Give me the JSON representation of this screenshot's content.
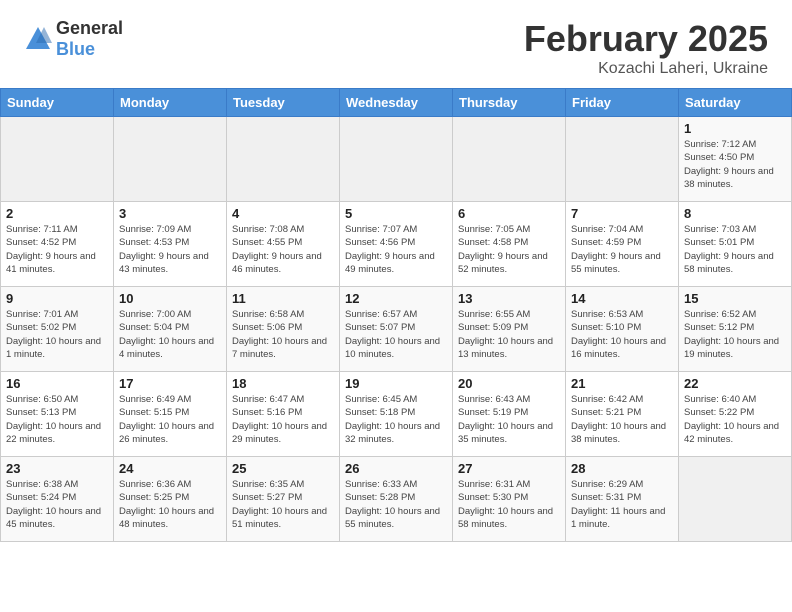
{
  "header": {
    "logo": {
      "general": "General",
      "blue": "Blue"
    },
    "title": "February 2025",
    "subtitle": "Kozachi Laheri, Ukraine"
  },
  "calendar": {
    "weekdays": [
      "Sunday",
      "Monday",
      "Tuesday",
      "Wednesday",
      "Thursday",
      "Friday",
      "Saturday"
    ],
    "weeks": [
      [
        {
          "day": "",
          "info": ""
        },
        {
          "day": "",
          "info": ""
        },
        {
          "day": "",
          "info": ""
        },
        {
          "day": "",
          "info": ""
        },
        {
          "day": "",
          "info": ""
        },
        {
          "day": "",
          "info": ""
        },
        {
          "day": "1",
          "info": "Sunrise: 7:12 AM\nSunset: 4:50 PM\nDaylight: 9 hours and 38 minutes."
        }
      ],
      [
        {
          "day": "2",
          "info": "Sunrise: 7:11 AM\nSunset: 4:52 PM\nDaylight: 9 hours and 41 minutes."
        },
        {
          "day": "3",
          "info": "Sunrise: 7:09 AM\nSunset: 4:53 PM\nDaylight: 9 hours and 43 minutes."
        },
        {
          "day": "4",
          "info": "Sunrise: 7:08 AM\nSunset: 4:55 PM\nDaylight: 9 hours and 46 minutes."
        },
        {
          "day": "5",
          "info": "Sunrise: 7:07 AM\nSunset: 4:56 PM\nDaylight: 9 hours and 49 minutes."
        },
        {
          "day": "6",
          "info": "Sunrise: 7:05 AM\nSunset: 4:58 PM\nDaylight: 9 hours and 52 minutes."
        },
        {
          "day": "7",
          "info": "Sunrise: 7:04 AM\nSunset: 4:59 PM\nDaylight: 9 hours and 55 minutes."
        },
        {
          "day": "8",
          "info": "Sunrise: 7:03 AM\nSunset: 5:01 PM\nDaylight: 9 hours and 58 minutes."
        }
      ],
      [
        {
          "day": "9",
          "info": "Sunrise: 7:01 AM\nSunset: 5:02 PM\nDaylight: 10 hours and 1 minute."
        },
        {
          "day": "10",
          "info": "Sunrise: 7:00 AM\nSunset: 5:04 PM\nDaylight: 10 hours and 4 minutes."
        },
        {
          "day": "11",
          "info": "Sunrise: 6:58 AM\nSunset: 5:06 PM\nDaylight: 10 hours and 7 minutes."
        },
        {
          "day": "12",
          "info": "Sunrise: 6:57 AM\nSunset: 5:07 PM\nDaylight: 10 hours and 10 minutes."
        },
        {
          "day": "13",
          "info": "Sunrise: 6:55 AM\nSunset: 5:09 PM\nDaylight: 10 hours and 13 minutes."
        },
        {
          "day": "14",
          "info": "Sunrise: 6:53 AM\nSunset: 5:10 PM\nDaylight: 10 hours and 16 minutes."
        },
        {
          "day": "15",
          "info": "Sunrise: 6:52 AM\nSunset: 5:12 PM\nDaylight: 10 hours and 19 minutes."
        }
      ],
      [
        {
          "day": "16",
          "info": "Sunrise: 6:50 AM\nSunset: 5:13 PM\nDaylight: 10 hours and 22 minutes."
        },
        {
          "day": "17",
          "info": "Sunrise: 6:49 AM\nSunset: 5:15 PM\nDaylight: 10 hours and 26 minutes."
        },
        {
          "day": "18",
          "info": "Sunrise: 6:47 AM\nSunset: 5:16 PM\nDaylight: 10 hours and 29 minutes."
        },
        {
          "day": "19",
          "info": "Sunrise: 6:45 AM\nSunset: 5:18 PM\nDaylight: 10 hours and 32 minutes."
        },
        {
          "day": "20",
          "info": "Sunrise: 6:43 AM\nSunset: 5:19 PM\nDaylight: 10 hours and 35 minutes."
        },
        {
          "day": "21",
          "info": "Sunrise: 6:42 AM\nSunset: 5:21 PM\nDaylight: 10 hours and 38 minutes."
        },
        {
          "day": "22",
          "info": "Sunrise: 6:40 AM\nSunset: 5:22 PM\nDaylight: 10 hours and 42 minutes."
        }
      ],
      [
        {
          "day": "23",
          "info": "Sunrise: 6:38 AM\nSunset: 5:24 PM\nDaylight: 10 hours and 45 minutes."
        },
        {
          "day": "24",
          "info": "Sunrise: 6:36 AM\nSunset: 5:25 PM\nDaylight: 10 hours and 48 minutes."
        },
        {
          "day": "25",
          "info": "Sunrise: 6:35 AM\nSunset: 5:27 PM\nDaylight: 10 hours and 51 minutes."
        },
        {
          "day": "26",
          "info": "Sunrise: 6:33 AM\nSunset: 5:28 PM\nDaylight: 10 hours and 55 minutes."
        },
        {
          "day": "27",
          "info": "Sunrise: 6:31 AM\nSunset: 5:30 PM\nDaylight: 10 hours and 58 minutes."
        },
        {
          "day": "28",
          "info": "Sunrise: 6:29 AM\nSunset: 5:31 PM\nDaylight: 11 hours and 1 minute."
        },
        {
          "day": "",
          "info": ""
        }
      ]
    ]
  }
}
